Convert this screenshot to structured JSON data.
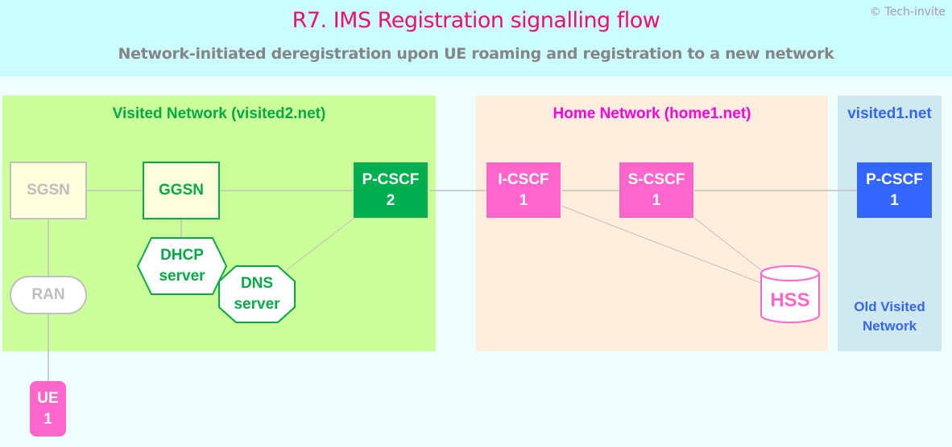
{
  "header": {
    "title": "R7. IMS Registration signalling flow",
    "subtitle": "Network-initiated deregistration upon UE roaming and registration to a new network",
    "copyright": "© Tech-invite"
  },
  "zones": {
    "visited2": {
      "label": "Visited Network (visited2.net)",
      "color": "#00aa44",
      "background": "#ccff99"
    },
    "home": {
      "label": "Home Network (home1.net)",
      "color": "#ff00dd",
      "background": "#ffeedd"
    },
    "visited1": {
      "label": "visited1.net",
      "sub_label_line1": "Old Visited",
      "sub_label_line2": "Network",
      "color": "#3366ff",
      "background": "#d0e8ef"
    }
  },
  "nodes": {
    "sgsn": {
      "line1": "SGSN",
      "state": "inactive"
    },
    "ggsn": {
      "line1": "GGSN",
      "state": "active"
    },
    "dhcp": {
      "line1": "DHCP",
      "line2": "server"
    },
    "dns": {
      "line1": "DNS",
      "line2": "server"
    },
    "pcscf2": {
      "line1": "P-CSCF",
      "line2": "2"
    },
    "icscf1": {
      "line1": "I-CSCF",
      "line2": "1"
    },
    "scscf1": {
      "line1": "S-CSCF",
      "line2": "1"
    },
    "hss": {
      "line1": "HSS"
    },
    "pcscf1": {
      "line1": "P-CSCF",
      "line2": "1"
    },
    "ran": {
      "line1": "RAN",
      "state": "inactive"
    },
    "ue1": {
      "line1": "UE",
      "line2": "1"
    }
  },
  "links": [
    {
      "from": "sgsn",
      "to": "ggsn"
    },
    {
      "from": "ggsn",
      "to": "pcscf2"
    },
    {
      "from": "ggsn",
      "to": "dhcp"
    },
    {
      "from": "pcscf2",
      "to": "dns"
    },
    {
      "from": "pcscf2",
      "to": "icscf1"
    },
    {
      "from": "icscf1",
      "to": "scscf1"
    },
    {
      "from": "scscf1",
      "to": "pcscf1"
    },
    {
      "from": "icscf1",
      "to": "hss"
    },
    {
      "from": "scscf1",
      "to": "hss"
    },
    {
      "from": "sgsn",
      "to": "ran"
    },
    {
      "from": "ran",
      "to": "ue1"
    }
  ],
  "colors": {
    "accent_title": "#ef0d6f",
    "visited_green": "#00b050",
    "home_pink": "#ff66cc",
    "old_visited_blue": "#3366ff",
    "inactive_gray": "#c0c0c0"
  }
}
